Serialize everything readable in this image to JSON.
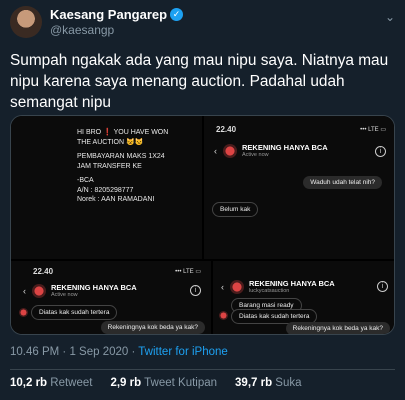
{
  "user": {
    "name": "Kaesang Pangarep",
    "handle": "@kaesangp"
  },
  "tweet": {
    "text": "Sumpah ngakak ada yang mau nipu saya. Niatnya mau nipu karena saya menang auction. Padahal udah semangat nipu"
  },
  "media": {
    "a": {
      "lines": [
        "HI BRO ❗ YOU HAVE WON THE AUCTION 😺😼",
        "PEMBAYARAN MAKS 1X24 JAM TRANSFER KE",
        "-BCA",
        "A/N : 8205298777",
        "Norek : AAN RAMADANI"
      ]
    },
    "b": {
      "time": "22.40",
      "status": "••• LTE ▭",
      "contact": "REKENING HANYA BCA",
      "sub": "Active now",
      "msg_out": "Waduh udah telat nih?",
      "msg_in": "Belum kak"
    },
    "c": {
      "time": "22.40",
      "status": "••• LTE ▭",
      "contact": "REKENING HANYA BCA",
      "sub": "Active now",
      "msg_in": "Diatas kak sudah tertera",
      "msg_out": "Rekeningnya kok beda ya kak?"
    },
    "d": {
      "contact": "REKENING HANYA BCA",
      "sub": "luckycatsauction",
      "msg_in1": "Barang masi ready",
      "msg_in2": "Diatas kak sudah tertera",
      "msg_out": "Rekeningnya kok beda ya kak?"
    }
  },
  "meta": {
    "time": "10.46 PM · 1 Sep 2020 · ",
    "source": "Twitter for iPhone"
  },
  "stats": {
    "retweets": "10,2 rb",
    "retweets_label": " Retweet",
    "quotes": "2,9 rb",
    "quotes_label": " Tweet Kutipan",
    "likes": "39,7 rb",
    "likes_label": " Suka"
  }
}
